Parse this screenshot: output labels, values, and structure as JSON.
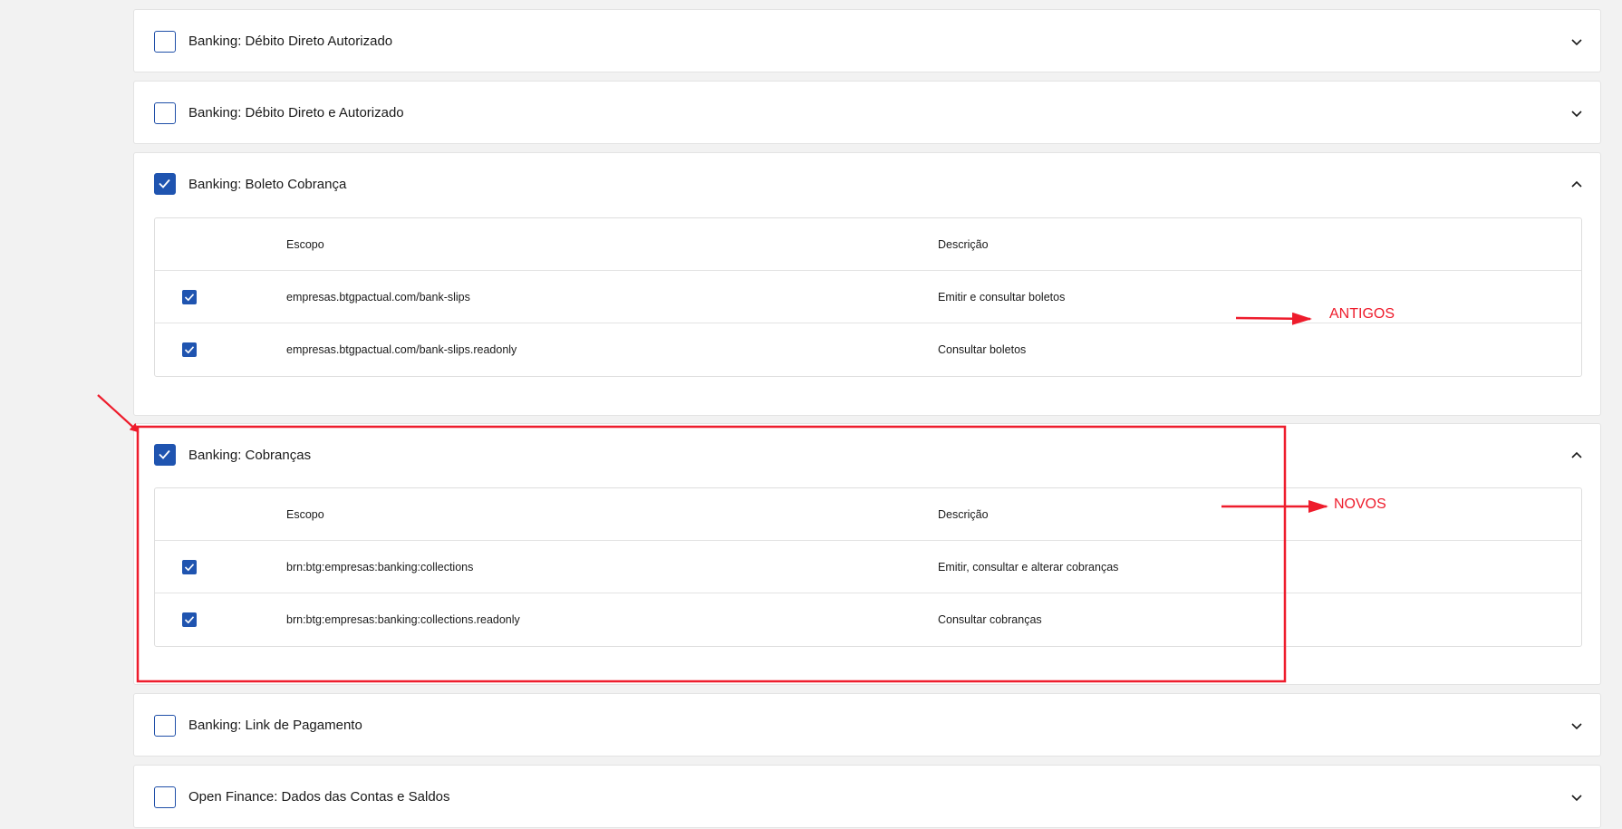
{
  "colors": {
    "accent": "#1f54b0",
    "annotation": "#ee1c2c",
    "background": "#f2f2f2"
  },
  "cards": [
    {
      "title": "Banking: Débito Direto Autorizado",
      "checked": false,
      "expanded": false
    },
    {
      "title": "Banking: Débito Direto e Autorizado",
      "checked": false,
      "expanded": false
    },
    {
      "title": "Banking: Boleto Cobrança",
      "checked": true,
      "expanded": true
    },
    {
      "title": "Banking: Cobranças",
      "checked": true,
      "expanded": true
    },
    {
      "title": "Banking: Link de Pagamento",
      "checked": false,
      "expanded": false
    },
    {
      "title": "Open Finance: Dados das Contas e Saldos",
      "checked": false,
      "expanded": false
    }
  ],
  "tables": {
    "boleto": {
      "header": {
        "scope": "Escopo",
        "description": "Descrição"
      },
      "rows": [
        {
          "checked": true,
          "scope": "empresas.btgpactual.com/bank-slips",
          "description": "Emitir e consultar boletos"
        },
        {
          "checked": true,
          "scope": "empresas.btgpactual.com/bank-slips.readonly",
          "description": "Consultar boletos"
        }
      ]
    },
    "cobrancas": {
      "header": {
        "scope": "Escopo",
        "description": "Descrição"
      },
      "rows": [
        {
          "checked": true,
          "scope": "brn:btg:empresas:banking:collections",
          "description": "Emitir, consultar e alterar cobranças"
        },
        {
          "checked": true,
          "scope": "brn:btg:empresas:banking:collections.readonly",
          "description": "Consultar cobranças"
        }
      ]
    }
  },
  "annotations": {
    "antigos": "ANTIGOS",
    "novos": "NOVOS"
  },
  "icons": [
    "checkbox-checked-icon",
    "checkbox-empty-icon",
    "chevron-down-icon",
    "chevron-up-icon",
    "annotation-arrow-icon"
  ]
}
